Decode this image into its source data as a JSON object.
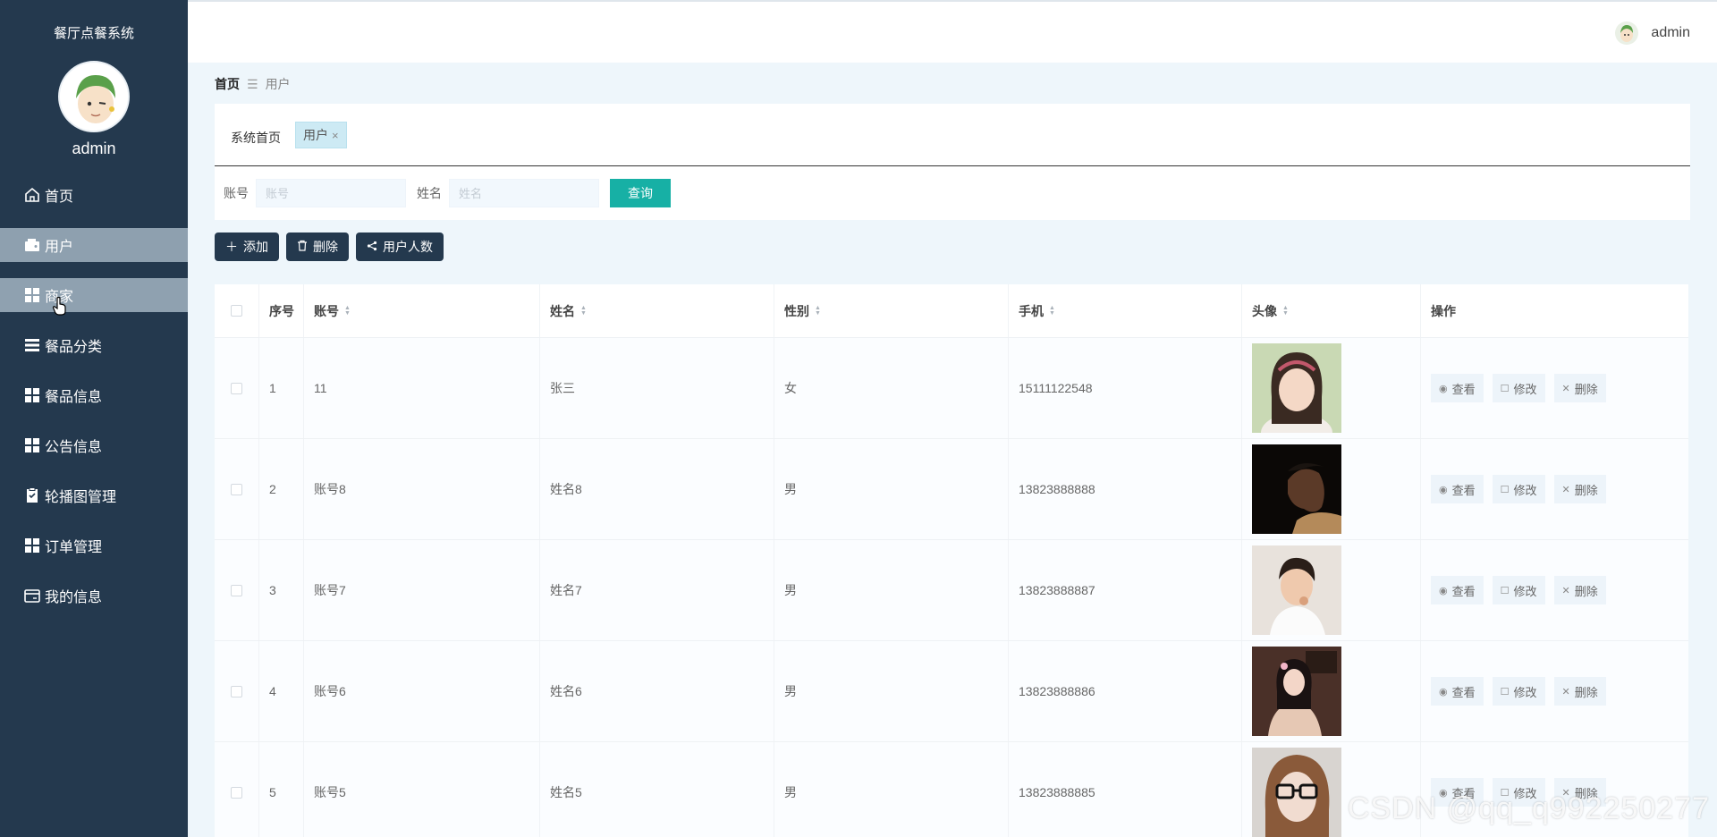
{
  "sidebar": {
    "app_title": "餐厅点餐系统",
    "username": "admin",
    "menu": [
      {
        "label": "首页",
        "icon": "home-icon"
      },
      {
        "label": "用户",
        "icon": "wallet-icon"
      },
      {
        "label": "商家",
        "icon": "grid-icon"
      },
      {
        "label": "餐品分类",
        "icon": "list-icon"
      },
      {
        "label": "餐品信息",
        "icon": "grid-icon"
      },
      {
        "label": "公告信息",
        "icon": "grid-icon"
      },
      {
        "label": "轮播图管理",
        "icon": "clipboard-icon"
      },
      {
        "label": "订单管理",
        "icon": "grid-icon"
      },
      {
        "label": "我的信息",
        "icon": "card-icon"
      }
    ]
  },
  "header": {
    "username": "admin"
  },
  "breadcrumb": {
    "home": "首页",
    "current": "用户"
  },
  "tabs": {
    "home": "系统首页",
    "active": "用户",
    "close": "×"
  },
  "search": {
    "account_label": "账号",
    "account_placeholder": "账号",
    "name_label": "姓名",
    "name_placeholder": "姓名",
    "button": "查询"
  },
  "toolbar": {
    "add": "添加",
    "delete": "删除",
    "user_count": "用户人数"
  },
  "table": {
    "headers": {
      "no": "序号",
      "account": "账号",
      "name": "姓名",
      "sex": "性别",
      "phone": "手机",
      "avatar": "头像",
      "ops": "操作"
    },
    "ops": {
      "view": "查看",
      "edit": "修改",
      "delete": "删除"
    },
    "rows": [
      {
        "no": "1",
        "account": "11",
        "name": "张三",
        "sex": "女",
        "phone": "15111122548"
      },
      {
        "no": "2",
        "account": "账号8",
        "name": "姓名8",
        "sex": "男",
        "phone": "13823888888"
      },
      {
        "no": "3",
        "account": "账号7",
        "name": "姓名7",
        "sex": "男",
        "phone": "13823888887"
      },
      {
        "no": "4",
        "account": "账号6",
        "name": "姓名6",
        "sex": "男",
        "phone": "13823888886"
      },
      {
        "no": "5",
        "account": "账号5",
        "name": "姓名5",
        "sex": "男",
        "phone": "13823888885"
      }
    ]
  },
  "watermark": "CSDN @qq_q992250277",
  "colors": {
    "sidebar": "#24394e",
    "accent": "#17b0a5",
    "active_menu": "#8ea0af"
  }
}
